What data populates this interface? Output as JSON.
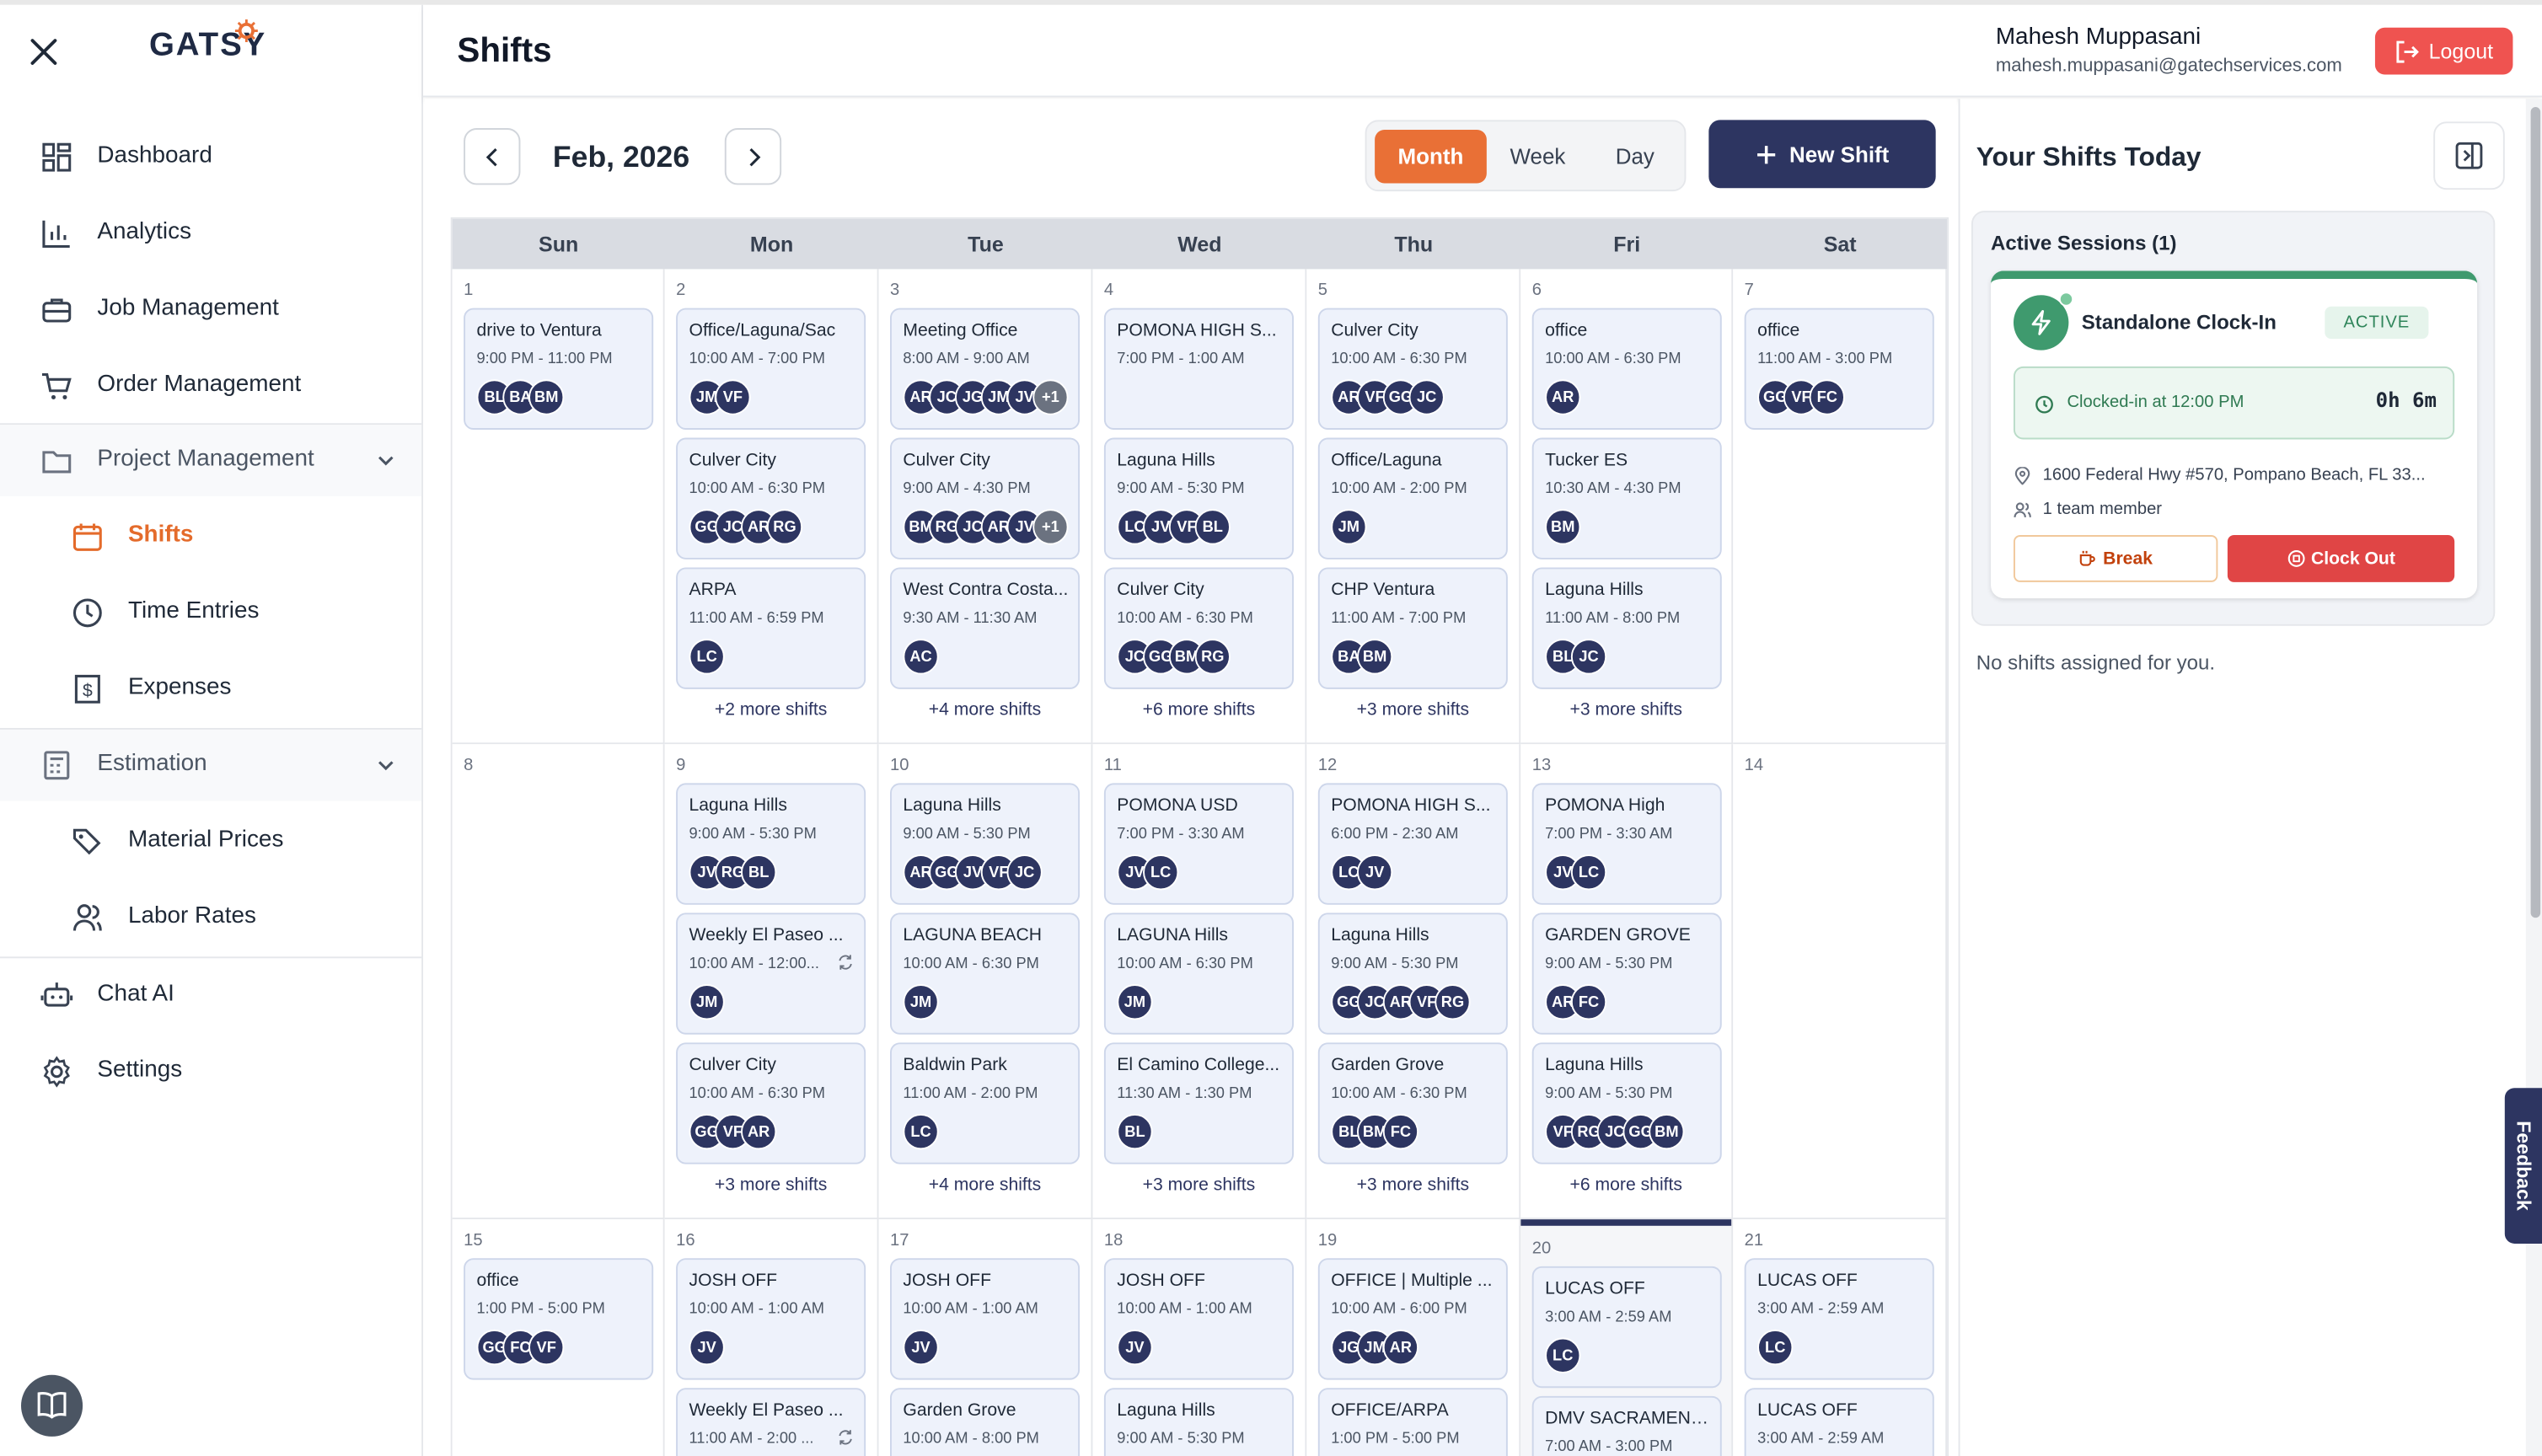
{
  "app": {
    "logo_text": "GATSY"
  },
  "sidebar": {
    "items": [
      {
        "label": "Dashboard",
        "icon": "dashboard-icon"
      },
      {
        "label": "Analytics",
        "icon": "bar-chart-icon"
      },
      {
        "label": "Job Management",
        "icon": "briefcase-icon"
      },
      {
        "label": "Order Management",
        "icon": "cart-icon"
      },
      {
        "label": "Project Management",
        "icon": "folder-icon"
      },
      {
        "label": "Shifts",
        "icon": "calendar-icon"
      },
      {
        "label": "Time Entries",
        "icon": "clock-icon"
      },
      {
        "label": "Expenses",
        "icon": "dollar-icon"
      },
      {
        "label": "Estimation",
        "icon": "calculator-icon"
      },
      {
        "label": "Material Prices",
        "icon": "tags-icon"
      },
      {
        "label": "Labor Rates",
        "icon": "users-icon"
      },
      {
        "label": "Chat AI",
        "icon": "bot-icon"
      },
      {
        "label": "Settings",
        "icon": "gear-icon"
      }
    ],
    "active_item": "Shifts",
    "accent_color": "#e46b2b"
  },
  "header": {
    "title": "Shifts",
    "user_name": "Mahesh Muppasani",
    "user_email": "mahesh.muppasani@gatechservices.com",
    "logout_label": "Logout"
  },
  "toolbar": {
    "month_label": "Feb, 2026",
    "views": [
      "Month",
      "Week",
      "Day"
    ],
    "active_view": "Month",
    "new_shift_label": "New Shift"
  },
  "calendar": {
    "weekdays": [
      "Sun",
      "Mon",
      "Tue",
      "Wed",
      "Thu",
      "Fri",
      "Sat"
    ],
    "weeks": [
      [
        {
          "day": "1",
          "events": [
            {
              "title": "drive to Ventura",
              "time": "9:00 PM - 11:00 PM",
              "people": [
                "BL",
                "BA",
                "BM"
              ]
            }
          ],
          "more": ""
        },
        {
          "day": "2",
          "events": [
            {
              "title": "Office/Laguna/Sac",
              "time": "10:00 AM - 7:00 PM",
              "people": [
                "JM",
                "VF"
              ]
            },
            {
              "title": "Culver City",
              "time": "10:00 AM - 6:30 PM",
              "people": [
                "GG",
                "JC",
                "AR",
                "RG"
              ]
            },
            {
              "title": "ARPA",
              "time": "11:00 AM - 6:59 PM",
              "people": [
                "LC"
              ]
            }
          ],
          "more": "+2 more shifts"
        },
        {
          "day": "3",
          "events": [
            {
              "title": "Meeting Office",
              "time": "8:00 AM - 9:00 AM",
              "people": [
                "AR",
                "JC",
                "JG",
                "JM",
                "JV",
                "+1"
              ]
            },
            {
              "title": "Culver City",
              "time": "9:00 AM - 4:30 PM",
              "people": [
                "BM",
                "RG",
                "JC",
                "AR",
                "JV",
                "+1"
              ]
            },
            {
              "title": "West Contra Costa...",
              "time": "9:30 AM - 11:30 AM",
              "people": [
                "AC"
              ]
            }
          ],
          "more": "+4 more shifts"
        },
        {
          "day": "4",
          "events": [
            {
              "title": "POMONA HIGH S...",
              "time": "7:00 PM - 1:00 AM",
              "people": []
            },
            {
              "title": "Laguna Hills",
              "time": "9:00 AM - 5:30 PM",
              "people": [
                "LC",
                "JV",
                "VF",
                "BL"
              ]
            },
            {
              "title": "Culver City",
              "time": "10:00 AM - 6:30 PM",
              "people": [
                "JC",
                "GG",
                "BM",
                "RG"
              ]
            }
          ],
          "more": "+6 more shifts"
        },
        {
          "day": "5",
          "events": [
            {
              "title": "Culver City",
              "time": "10:00 AM - 6:30 PM",
              "people": [
                "AR",
                "VF",
                "GG",
                "JC"
              ]
            },
            {
              "title": "Office/Laguna",
              "time": "10:00 AM - 2:00 PM",
              "people": [
                "JM"
              ]
            },
            {
              "title": "CHP Ventura",
              "time": "11:00 AM - 7:00 PM",
              "people": [
                "BA",
                "BM"
              ]
            }
          ],
          "more": "+3 more shifts"
        },
        {
          "day": "6",
          "events": [
            {
              "title": "office",
              "time": "10:00 AM - 6:30 PM",
              "people": [
                "AR"
              ]
            },
            {
              "title": "Tucker ES",
              "time": "10:30 AM - 4:30 PM",
              "people": [
                "BM"
              ]
            },
            {
              "title": "Laguna Hills",
              "time": "11:00 AM - 8:00 PM",
              "people": [
                "BL",
                "JC"
              ]
            }
          ],
          "more": "+3 more shifts"
        },
        {
          "day": "7",
          "events": [
            {
              "title": "office",
              "time": "11:00 AM - 3:00 PM",
              "people": [
                "GG",
                "VF",
                "FC"
              ]
            }
          ],
          "more": ""
        }
      ],
      [
        {
          "day": "8",
          "events": [],
          "more": ""
        },
        {
          "day": "9",
          "events": [
            {
              "title": "Laguna Hills",
              "time": "9:00 AM - 5:30 PM",
              "people": [
                "JV",
                "RG",
                "BL"
              ]
            },
            {
              "title": "Weekly El Paseo ...",
              "time": "10:00 AM - 12:00...",
              "people": [
                "JM"
              ],
              "repeat": true
            },
            {
              "title": "Culver City",
              "time": "10:00 AM - 6:30 PM",
              "people": [
                "GG",
                "VF",
                "AR"
              ]
            }
          ],
          "more": "+3 more shifts"
        },
        {
          "day": "10",
          "events": [
            {
              "title": "Laguna Hills",
              "time": "9:00 AM - 5:30 PM",
              "people": [
                "AR",
                "GG",
                "JV",
                "VF",
                "JC"
              ]
            },
            {
              "title": "LAGUNA BEACH",
              "time": "10:00 AM - 6:30 PM",
              "people": [
                "JM"
              ]
            },
            {
              "title": "Baldwin Park",
              "time": "11:00 AM - 2:00 PM",
              "people": [
                "LC"
              ]
            }
          ],
          "more": "+4 more shifts"
        },
        {
          "day": "11",
          "events": [
            {
              "title": "POMONA USD",
              "time": "7:00 PM - 3:30 AM",
              "people": [
                "JV",
                "LC"
              ]
            },
            {
              "title": "LAGUNA Hills",
              "time": "10:00 AM - 6:30 PM",
              "people": [
                "JM"
              ]
            },
            {
              "title": "El Camino College...",
              "time": "11:30 AM - 1:30 PM",
              "people": [
                "BL"
              ]
            }
          ],
          "more": "+3 more shifts"
        },
        {
          "day": "12",
          "events": [
            {
              "title": "POMONA HIGH S...",
              "time": "6:00 PM - 2:30 AM",
              "people": [
                "LC",
                "JV"
              ]
            },
            {
              "title": "Laguna Hills",
              "time": "9:00 AM - 5:30 PM",
              "people": [
                "GG",
                "JC",
                "AR",
                "VF",
                "RG"
              ]
            },
            {
              "title": "Garden Grove",
              "time": "10:00 AM - 6:30 PM",
              "people": [
                "BL",
                "BM",
                "FC"
              ]
            }
          ],
          "more": "+3 more shifts"
        },
        {
          "day": "13",
          "events": [
            {
              "title": "POMONA High",
              "time": "7:00 PM - 3:30 AM",
              "people": [
                "JV",
                "LC"
              ]
            },
            {
              "title": "GARDEN GROVE",
              "time": "9:00 AM - 5:30 PM",
              "people": [
                "AR",
                "FC"
              ]
            },
            {
              "title": "Laguna Hills",
              "time": "9:00 AM - 5:30 PM",
              "people": [
                "VF",
                "RG",
                "JC",
                "GG",
                "BM"
              ]
            }
          ],
          "more": "+6 more shifts"
        },
        {
          "day": "14",
          "events": [],
          "more": ""
        }
      ],
      [
        {
          "day": "15",
          "events": [
            {
              "title": "office",
              "time": "1:00 PM - 5:00 PM",
              "people": [
                "GG",
                "FC",
                "VF"
              ]
            }
          ],
          "more": ""
        },
        {
          "day": "16",
          "events": [
            {
              "title": "JOSH OFF",
              "time": "10:00 AM - 1:00 AM",
              "people": [
                "JV"
              ]
            },
            {
              "title": "Weekly El Paseo ...",
              "time": "11:00 AM - 2:00 ...",
              "people": [],
              "repeat": true
            }
          ],
          "more": ""
        },
        {
          "day": "17",
          "events": [
            {
              "title": "JOSH OFF",
              "time": "10:00 AM - 1:00 AM",
              "people": [
                "JV"
              ]
            },
            {
              "title": "Garden Grove",
              "time": "10:00 AM - 8:00 PM",
              "people": []
            }
          ],
          "more": ""
        },
        {
          "day": "18",
          "events": [
            {
              "title": "JOSH OFF",
              "time": "10:00 AM - 1:00 AM",
              "people": [
                "JV"
              ]
            },
            {
              "title": "Laguna Hills",
              "time": "9:00 AM - 5:30 PM",
              "people": []
            }
          ],
          "more": ""
        },
        {
          "day": "19",
          "events": [
            {
              "title": "OFFICE | Multiple ...",
              "time": "10:00 AM - 6:00 PM",
              "people": [
                "JG",
                "JM",
                "AR"
              ]
            },
            {
              "title": "OFFICE/ARPA",
              "time": "1:00 PM - 5:00 PM",
              "people": []
            }
          ],
          "more": ""
        },
        {
          "day": "20",
          "today": true,
          "events": [
            {
              "title": "LUCAS OFF",
              "time": "3:00 AM - 2:59 AM",
              "people": [
                "LC"
              ]
            },
            {
              "title": "DMV SACRAMENTO",
              "time": "7:00 AM - 3:00 PM",
              "people": []
            }
          ],
          "more": ""
        },
        {
          "day": "21",
          "events": [
            {
              "title": "LUCAS OFF",
              "time": "3:00 AM - 2:59 AM",
              "people": [
                "LC"
              ]
            },
            {
              "title": "LUCAS OFF",
              "time": "3:00 AM - 2:59 AM",
              "people": []
            }
          ],
          "more": ""
        }
      ]
    ]
  },
  "right_panel": {
    "title": "Your Shifts Today",
    "active_sessions_label": "Active Sessions (1)",
    "session": {
      "name": "Standalone Clock-In",
      "status": "ACTIVE",
      "clocked_in": "Clocked-in at 12:00 PM",
      "duration": "0h 6m",
      "address": "1600 Federal Hwy #570, Pompano Beach, FL 33...",
      "team": "1 team member",
      "break_label": "Break",
      "clock_out_label": "Clock Out"
    },
    "no_shifts": "No shifts assigned for you."
  },
  "feedback_label": "Feedback",
  "colors": {
    "navy": "#2d3561",
    "orange": "#e97036",
    "green": "#3f9a6e",
    "red": "#ef5350"
  }
}
